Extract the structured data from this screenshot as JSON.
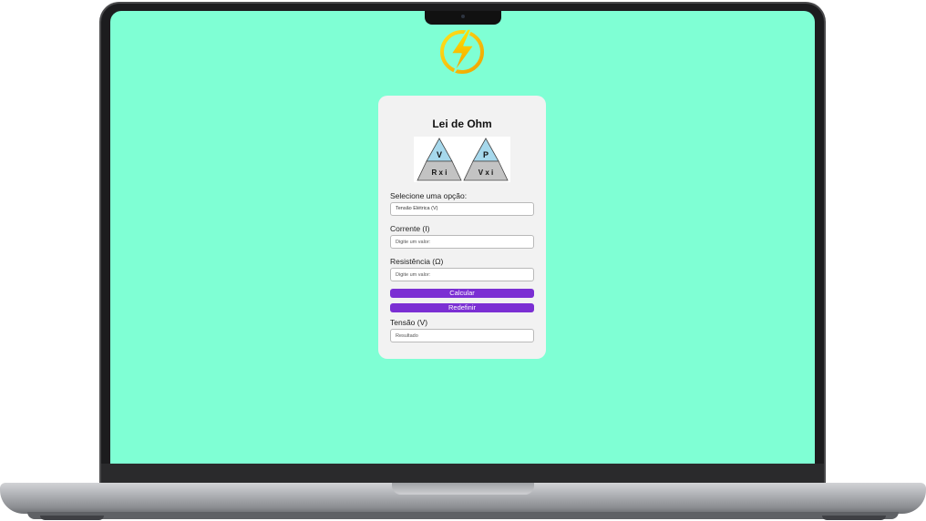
{
  "app": {
    "title": "Lei de Ohm"
  },
  "formula_diagram": {
    "left": {
      "top": "V",
      "bottom": "R x i"
    },
    "right": {
      "top": "P",
      "bottom": "V x i"
    }
  },
  "form": {
    "select_label": "Selecione uma opção:",
    "select_value": "Tensão Elétrica (V)",
    "field1_label": "Corrente (I)",
    "field1_placeholder": "Digite um valor:",
    "field2_label": "Resistência (Ω)",
    "field2_placeholder": "Digite um valor:",
    "calculate_label": "Calcular",
    "reset_label": "Redefinir",
    "result_label": "Tensão (V)",
    "result_placeholder": "Resultado"
  },
  "colors": {
    "page_background": "#7fffd4",
    "card_background": "#f2f2f2",
    "button": "#7b2fd3",
    "triangle_top": "#a6d8ec",
    "triangle_bottom": "#c3c3c3",
    "logo": "#f5c400"
  },
  "icons": {
    "logo": "lightning-bolt-circle-icon"
  }
}
